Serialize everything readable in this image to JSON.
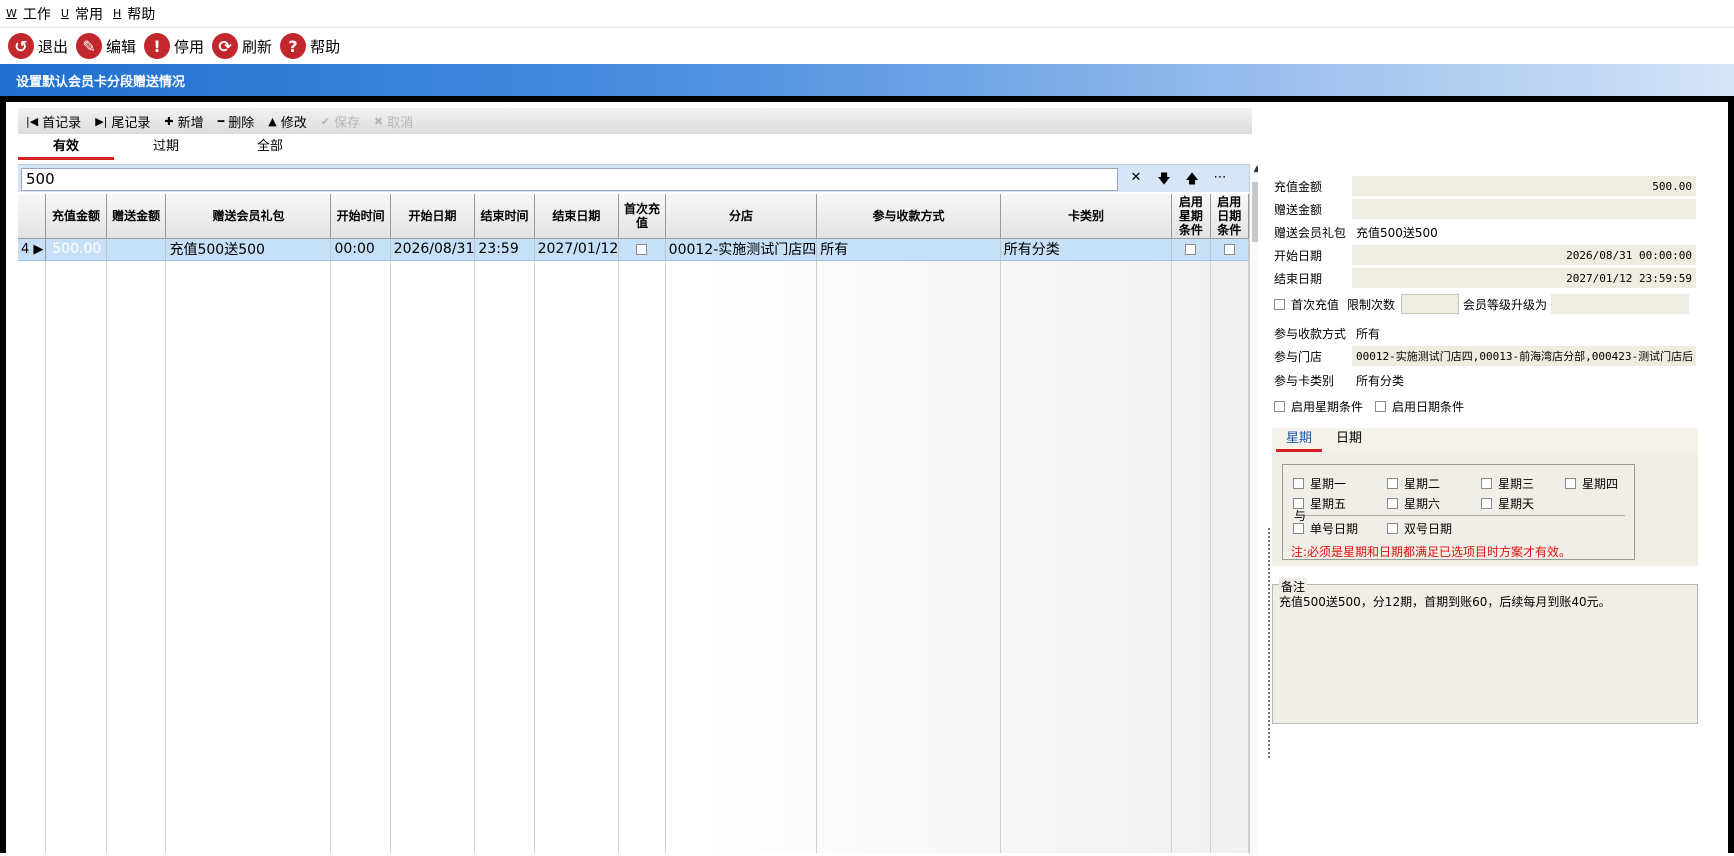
{
  "menu": [
    {
      "key": "W",
      "label": "工作"
    },
    {
      "key": "U",
      "label": "常用"
    },
    {
      "key": "H",
      "label": "帮助"
    }
  ],
  "toolbar": {
    "exit_label": "退出",
    "edit_label": "编辑",
    "disable_label": "停用",
    "refresh_label": "刷新",
    "help_label": "帮助"
  },
  "title": "设置默认会员卡分段赠送情况",
  "record_toolbar": {
    "first_label": "首记录",
    "last_label": "尾记录",
    "add_label": "新增",
    "delete_label": "删除",
    "modify_label": "修改",
    "save_label": "保存",
    "cancel_label": "取消"
  },
  "status_tabs": [
    "有效",
    "过期",
    "全部"
  ],
  "filter": {
    "value": "500"
  },
  "grid": {
    "columns": [
      "充值金额",
      "赠送金额",
      "赠送会员礼包",
      "开始时间",
      "开始日期",
      "结束时间",
      "结束日期",
      "首次充值",
      "分店",
      "参与收款方式",
      "卡类别",
      "启用星期条件",
      "启用日期条件"
    ],
    "rows": [
      {
        "row_no": "4",
        "recharge": "500.00",
        "gift_amount": "",
        "gift_pack": "充值500送500",
        "start_time": "00:00",
        "start_date": "2026/08/31",
        "end_time": "23:59",
        "end_date": "2027/01/12",
        "branch": "00012-实施测试门店四",
        "payment": "所有",
        "card_type": "所有分类"
      }
    ]
  },
  "detail": {
    "recharge_label": "充值金额",
    "recharge_value": "500.00",
    "gift_amount_label": "赠送金额",
    "gift_amount_value": "",
    "gift_pack_label": "赠送会员礼包",
    "gift_pack_value": "充值500送500",
    "start_date_label": "开始日期",
    "start_date_value": "2026/08/31 00:00:00",
    "end_date_label": "结束日期",
    "end_date_value": "2027/01/12 23:59:59",
    "first_recharge_label": "首次充值",
    "limit_count_label": "限制次数",
    "limit_count_value": "",
    "upgrade_label": "会员等级升级为",
    "upgrade_value": "",
    "payment_label": "参与收款方式",
    "payment_value": "所有",
    "store_label": "参与门店",
    "store_value": "00012-实施测试门店四,00013-前海湾店分部,000423-测试门店后",
    "card_type_label": "参与卡类别",
    "card_type_value": "所有分类",
    "enable_week_label": "启用星期条件",
    "enable_date_label": "启用日期条件"
  },
  "cond_tabs": [
    "星期",
    "日期"
  ],
  "weekdays": [
    "星期一",
    "星期二",
    "星期三",
    "星期四",
    "星期五",
    "星期六",
    "星期天"
  ],
  "and_label": "与",
  "odd_date_label": "单号日期",
  "even_date_label": "双号日期",
  "cond_note": "注:必须是星期和日期都满足已选项目时方案才有效。",
  "notes_title": "备注",
  "notes_text": "充值500送500，分12期，首期到账60，后续每月到账40元。"
}
